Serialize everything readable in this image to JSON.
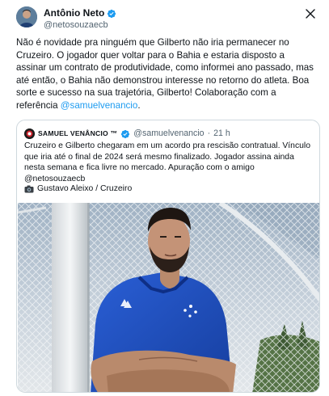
{
  "author": {
    "name": "Antônio Neto",
    "handle": "@netosouzaecb"
  },
  "tweet": {
    "text": "Não é novidade pra ninguém que Gilberto não iria permanecer no Cruzeiro. O jogador quer voltar para o Bahia e estaria disposto a assinar um contrato de produtividade, como informei ano passado, mas até então, o Bahia não demonstrou interesse no retorno do atleta. Boa sorte e sucesso na sua trajetória, Gilberto! Colaboração com a referência ",
    "mention": "@samuelvenancio",
    "end": "."
  },
  "quote": {
    "name": "SAMUEL VENÂNCIO ™",
    "handle": "@samuelvenancio",
    "separator": "·",
    "time": "21 h",
    "text": "Cruzeiro e Gilberto chegaram em um acordo pra rescisão contratual. Vínculo que iria até o final de 2024 será mesmo finalizado. Jogador assina ainda nesta semana e fica livre no mercado. Apuração com o amigo @netosouzaecb",
    "credit": "Gustavo Aleixo / Cruzeiro"
  },
  "icons": {
    "verified": "verified-badge-icon",
    "close": "close-icon",
    "camera": "camera-icon"
  },
  "colors": {
    "link": "#1d9bf0",
    "verified": "#1d9bf0",
    "jersey": "#1f4fc4",
    "secondary_text": "#536471",
    "border": "#cfd9de"
  }
}
